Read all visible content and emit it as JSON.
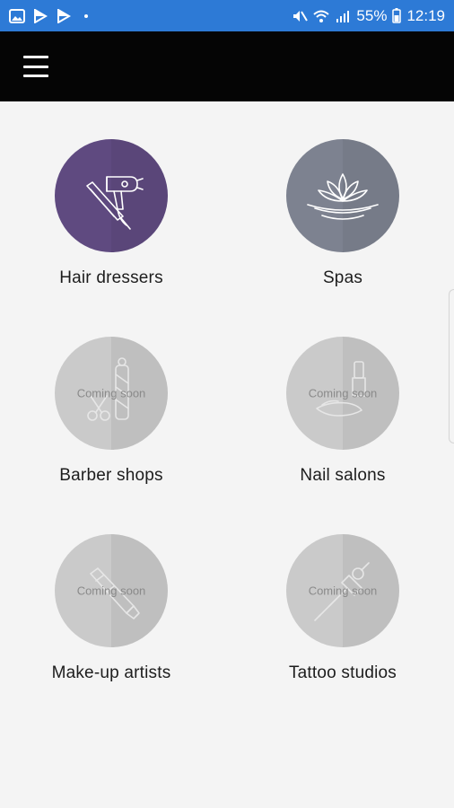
{
  "status_bar": {
    "battery": "55%",
    "time": "12:19",
    "left_icons": [
      "gallery-icon",
      "play-store-icon",
      "play-store-icon"
    ],
    "right_icons": [
      "mute-icon",
      "wifi-icon",
      "signal-icon",
      "battery-icon"
    ]
  },
  "app_bar": {
    "menu_icon": "hamburger-menu-icon"
  },
  "categories": [
    {
      "label": "Hair dressers",
      "icon": "hair-dryer-icon",
      "color": "#5f4a80",
      "overlay": ""
    },
    {
      "label": "Spas",
      "icon": "lotus-icon",
      "color": "#7d8290",
      "overlay": ""
    },
    {
      "label": "Barber shops",
      "icon": "barber-pole-icon",
      "color": "#cacaca",
      "overlay": "Coming soon"
    },
    {
      "label": "Nail salons",
      "icon": "nail-polish-icon",
      "color": "#cacaca",
      "overlay": "Coming soon"
    },
    {
      "label": "Make-up artists",
      "icon": "makeup-icon",
      "color": "#cacaca",
      "overlay": "Coming soon"
    },
    {
      "label": "Tattoo studios",
      "icon": "tattoo-machine-icon",
      "color": "#cacaca",
      "overlay": "Coming soon"
    }
  ]
}
